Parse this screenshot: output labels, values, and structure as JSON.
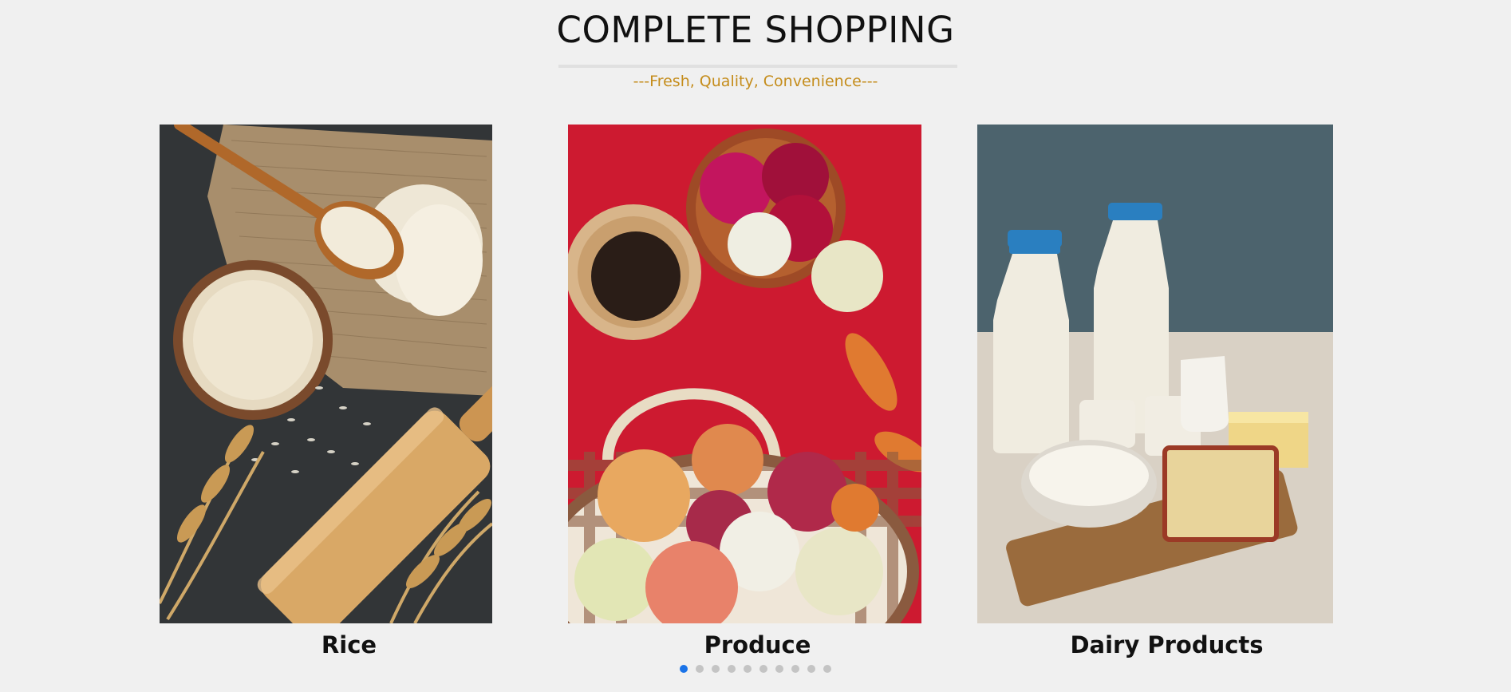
{
  "header": {
    "title": "COMPLETE SHOPPING",
    "subtitle": "---Fresh, Quality, Convenience---",
    "subtitle_color": "#c58d1c"
  },
  "carousel": {
    "cards": [
      {
        "label": "Rice",
        "image": "rice-photo"
      },
      {
        "label": "Produce",
        "image": "onions-produce-photo"
      },
      {
        "label": "Dairy Products",
        "image": "dairy-products-photo"
      }
    ],
    "dots_total": 10,
    "active_dot": 1,
    "active_color": "#1a73e8",
    "inactive_color": "#c4c4c4"
  }
}
